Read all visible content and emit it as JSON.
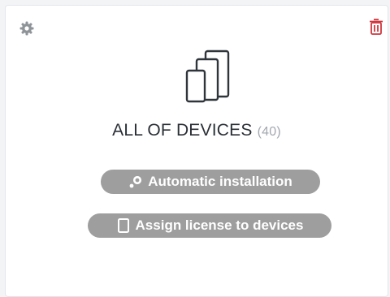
{
  "card": {
    "title": "ALL OF DEVICES",
    "count": "(40)"
  },
  "actions": {
    "automatic_installation": "Automatic installation",
    "assign_license": "Assign license to devices"
  },
  "icons": {
    "settings": "gear-icon",
    "delete": "trash-icon",
    "devices": "devices-icon",
    "automatic": "auto-install-icon",
    "assign": "device-outline-icon"
  },
  "colors": {
    "delete_red": "#d0363c",
    "pill_gray": "#9e9e9e",
    "icon_gray": "#8f9499",
    "title_text": "#2a2f36",
    "count_text": "#a3a8ae"
  }
}
